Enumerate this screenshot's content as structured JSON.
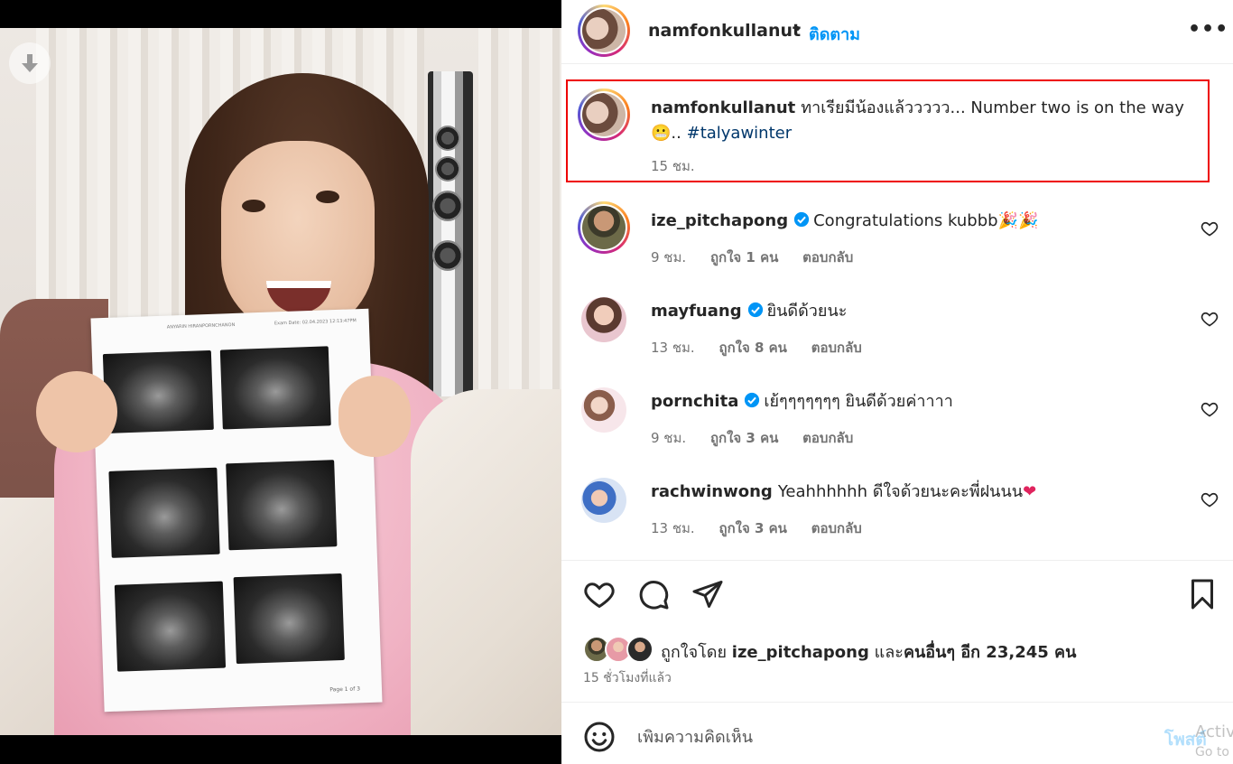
{
  "post": {
    "author": "namfonkullanut",
    "separator": "•",
    "follow_label": "ติดตาม",
    "more_label": "•••"
  },
  "caption": {
    "username": "namfonkullanut",
    "text": "ทาเรียมีน้องแล้ววววว... Number two is on the way",
    "emoji": "😬",
    "suffix": "..",
    "hashtag": "#talyawinter",
    "time": "15 ชม."
  },
  "comments": [
    {
      "username": "ize_pitchapong",
      "verified": true,
      "text": "Congratulations kubbb",
      "emoji": "🎉🎉",
      "time": "9 ชม.",
      "likes": "ถูกใจ 1 คน",
      "reply": "ตอบกลับ"
    },
    {
      "username": "mayfuang",
      "verified": true,
      "text": "ยินดีด้วยนะ",
      "emoji": "",
      "time": "13 ชม.",
      "likes": "ถูกใจ 8 คน",
      "reply": "ตอบกลับ"
    },
    {
      "username": "pornchita",
      "verified": true,
      "text": "เย้ๆๆๆๆๆๆๆ ยินดีด้วยค่าาาา",
      "emoji": "",
      "time": "9 ชม.",
      "likes": "ถูกใจ 3 คน",
      "reply": "ตอบกลับ"
    },
    {
      "username": "rachwinwong",
      "verified": false,
      "text": "Yeahhhhhh ดีใจด้วยนะคะพี่ฝนนน",
      "emoji": "❤",
      "time": "13 ชม.",
      "likes": "ถูกใจ 3 คน",
      "reply": "ตอบกลับ"
    }
  ],
  "likes_summary": {
    "prefix": "ถูกใจโดย",
    "user": "ize_pitchapong",
    "middle": "และ",
    "others": "คนอื่นๆ อีก 23,245 คน"
  },
  "post_time": "15 ชั่วโมงที่แล้ว",
  "add_comment": {
    "placeholder": "เพิ่มความคิดเห็น",
    "post_label": "โพสต์"
  },
  "photo_sheet": {
    "header_left": "ANYARIN HIRANPORNCHANON",
    "header_right": "Exam Date: 02.04.2023 12:13:47PM",
    "footer": "Page 1 of 3"
  },
  "watermark": [
    "Activ",
    "Go to"
  ],
  "colors": {
    "accent": "#0095f6",
    "highlight_border": "#e00000",
    "hashtag": "#00376b",
    "muted": "#737373"
  }
}
